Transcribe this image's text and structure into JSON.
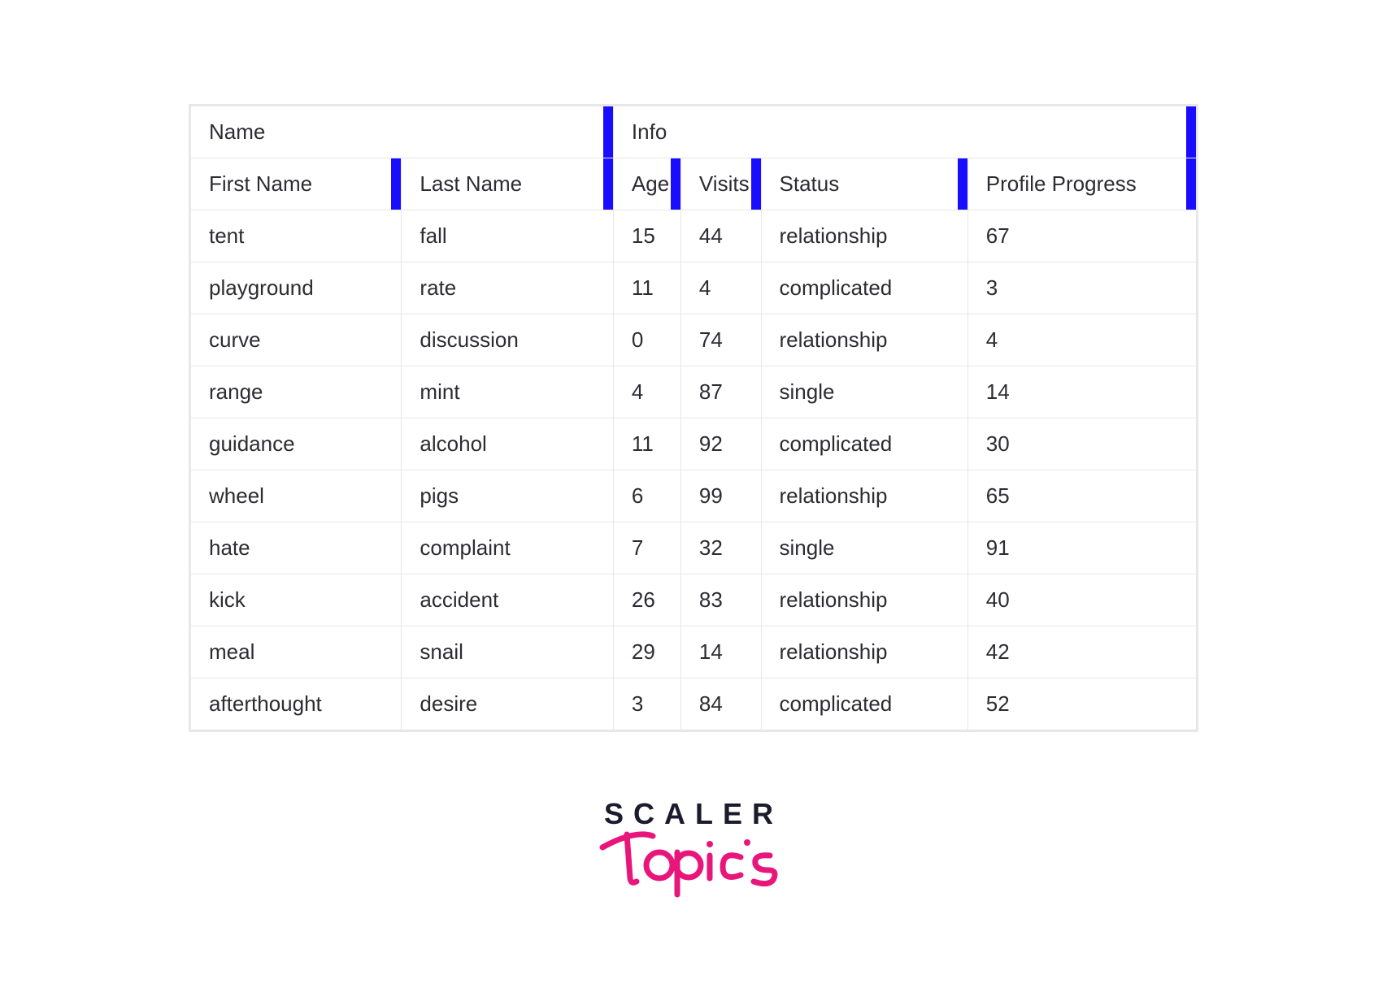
{
  "table": {
    "group_headers": {
      "name": "Name",
      "info": "Info"
    },
    "columns": {
      "first_name": "First Name",
      "last_name": "Last Name",
      "age": "Age",
      "visits": "Visits",
      "status": "Status",
      "profile_progress": "Profile Progress"
    },
    "rows": [
      {
        "first_name": "tent",
        "last_name": "fall",
        "age": 15,
        "visits": 44,
        "status": "relationship",
        "profile_progress": 67
      },
      {
        "first_name": "playground",
        "last_name": "rate",
        "age": 11,
        "visits": 4,
        "status": "complicated",
        "profile_progress": 3
      },
      {
        "first_name": "curve",
        "last_name": "discussion",
        "age": 0,
        "visits": 74,
        "status": "relationship",
        "profile_progress": 4
      },
      {
        "first_name": "range",
        "last_name": "mint",
        "age": 4,
        "visits": 87,
        "status": "single",
        "profile_progress": 14
      },
      {
        "first_name": "guidance",
        "last_name": "alcohol",
        "age": 11,
        "visits": 92,
        "status": "complicated",
        "profile_progress": 30
      },
      {
        "first_name": "wheel",
        "last_name": "pigs",
        "age": 6,
        "visits": 99,
        "status": "relationship",
        "profile_progress": 65
      },
      {
        "first_name": "hate",
        "last_name": "complaint",
        "age": 7,
        "visits": 32,
        "status": "single",
        "profile_progress": 91
      },
      {
        "first_name": "kick",
        "last_name": "accident",
        "age": 26,
        "visits": 83,
        "status": "relationship",
        "profile_progress": 40
      },
      {
        "first_name": "meal",
        "last_name": "snail",
        "age": 29,
        "visits": 14,
        "status": "relationship",
        "profile_progress": 42
      },
      {
        "first_name": "afterthought",
        "last_name": "desire",
        "age": 3,
        "visits": 84,
        "status": "complicated",
        "profile_progress": 52
      }
    ]
  },
  "brand": {
    "line1": "SCALER",
    "line2": "Topics",
    "colors": {
      "text": "#1b1b2d",
      "script": "#e8167b"
    }
  }
}
